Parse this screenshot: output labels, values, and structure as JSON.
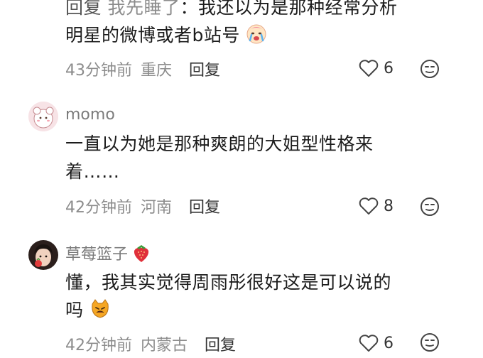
{
  "comments": [
    {
      "reply_prefix": "回复",
      "reply_to": "我先睡了",
      "line1": "：我还以为是那种经常分析",
      "line2": "明星的微博或者b站号",
      "emoji": "crying-face-emoji",
      "time": "43分钟前",
      "location": "重庆",
      "reply_label": "回复",
      "likes": "6"
    },
    {
      "username": "momo",
      "line1": "一直以为她是那种爽朗的大姐型性格来",
      "line2": "着……",
      "time": "42分钟前",
      "location": "河南",
      "reply_label": "回复",
      "likes": "8"
    },
    {
      "username": "草莓篮子",
      "username_emoji": "strawberry-emoji",
      "line1": "懂，我其实觉得周雨彤很好这是可以说的",
      "line2": "吗",
      "emoji": "cat-face-emoji",
      "time": "42分钟前",
      "location": "内蒙古",
      "reply_label": "回复",
      "likes": "6"
    }
  ],
  "colors": {
    "text": "#1c1c1c",
    "meta": "#8c8c8c",
    "icon": "#444444"
  }
}
